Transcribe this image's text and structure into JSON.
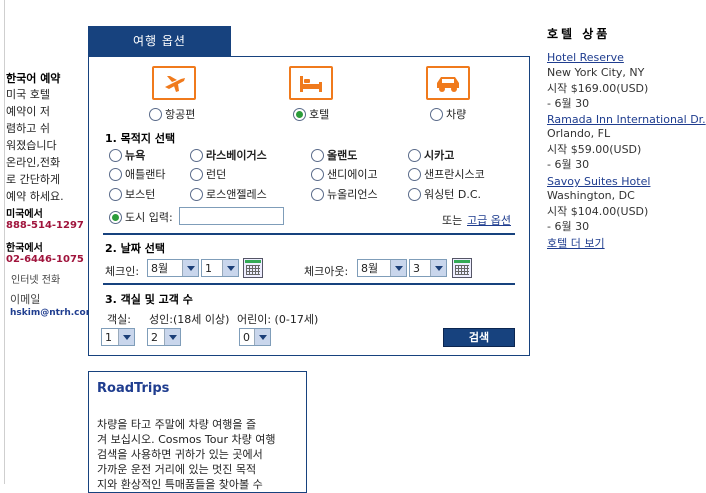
{
  "sidebar": {
    "title": "한국어 예약",
    "desc_lines": [
      "미국 호텔",
      "예약이 저",
      "렴하고 쉬",
      "워졌습니다",
      "온라인,전화",
      "로 간단하게",
      "예약 하세요."
    ],
    "us_label": "미국에서",
    "us_phone": "888-514-1297",
    "kr_label": "한국에서",
    "kr_phone": "02-6446-1075",
    "internet_phone": "인터넷 전화",
    "email_label": "이메일",
    "email": "hskim@ntrh.com"
  },
  "options": {
    "tab_label": "여행 옵션",
    "modes": [
      {
        "label": "항공편",
        "icon": "airplane-icon",
        "selected": false
      },
      {
        "label": "호텔",
        "icon": "bed-icon",
        "selected": true
      },
      {
        "label": "차량",
        "icon": "car-icon",
        "selected": false
      }
    ],
    "destination": {
      "heading": "1. 목적지 선택",
      "cities": [
        "뉴욕",
        "라스베이거스",
        "올랜도",
        "시카고",
        "애틀랜타",
        "런던",
        "샌디에이고",
        "샌프란시스코",
        "보스턴",
        "로스앤젤레스",
        "뉴올리언스",
        "워싱턴 D.C."
      ],
      "city_input_label": "도시 입력:",
      "city_input_value": "",
      "or_label": "또는",
      "advanced_link": "고급 옵션"
    },
    "dates": {
      "heading": "2. 날짜 선택",
      "checkin_label": "체크인:",
      "checkin_month": "8월",
      "checkin_day": "1",
      "checkout_label": "체크아웃:",
      "checkout_month": "8월",
      "checkout_day": "3"
    },
    "guests": {
      "heading": "3. 객실 및 고객 수",
      "rooms_label": "객실:",
      "adults_label": "성인:(18세 이상)",
      "children_label": "어린이: (0-17세)",
      "rooms_value": "1",
      "adults_value": "2",
      "children_value": "0"
    },
    "search_button": "검색"
  },
  "roadtrips": {
    "title": "RoadTrips",
    "lines": [
      "차량을 타고 주말에 차량 여행을 즐",
      "겨 보십시오. Cosmos Tour 차량 여행",
      "검색을 사용하면 귀하가 있는 곳에서",
      "가까운 운전 거리에 있는 멋진 목적",
      "지와 환상적인 특매품들을 찾아볼 수"
    ]
  },
  "hotels": {
    "title": "호텔 상품",
    "items": [
      {
        "name": "Hotel Reserve",
        "location": "New York City, NY",
        "price": "시작 $169.00(USD)",
        "date": "- 6월 30"
      },
      {
        "name": "Ramada Inn International Dr.",
        "location": "Orlando, FL",
        "price": "시작 $59.00(USD)",
        "date": "- 6월 30"
      },
      {
        "name": "Savoy Suites Hotel",
        "location": "Washington, DC",
        "price": "시작 $104.00(USD)",
        "date": "- 6월 30"
      }
    ],
    "more_link": "호텔 더 보기"
  }
}
